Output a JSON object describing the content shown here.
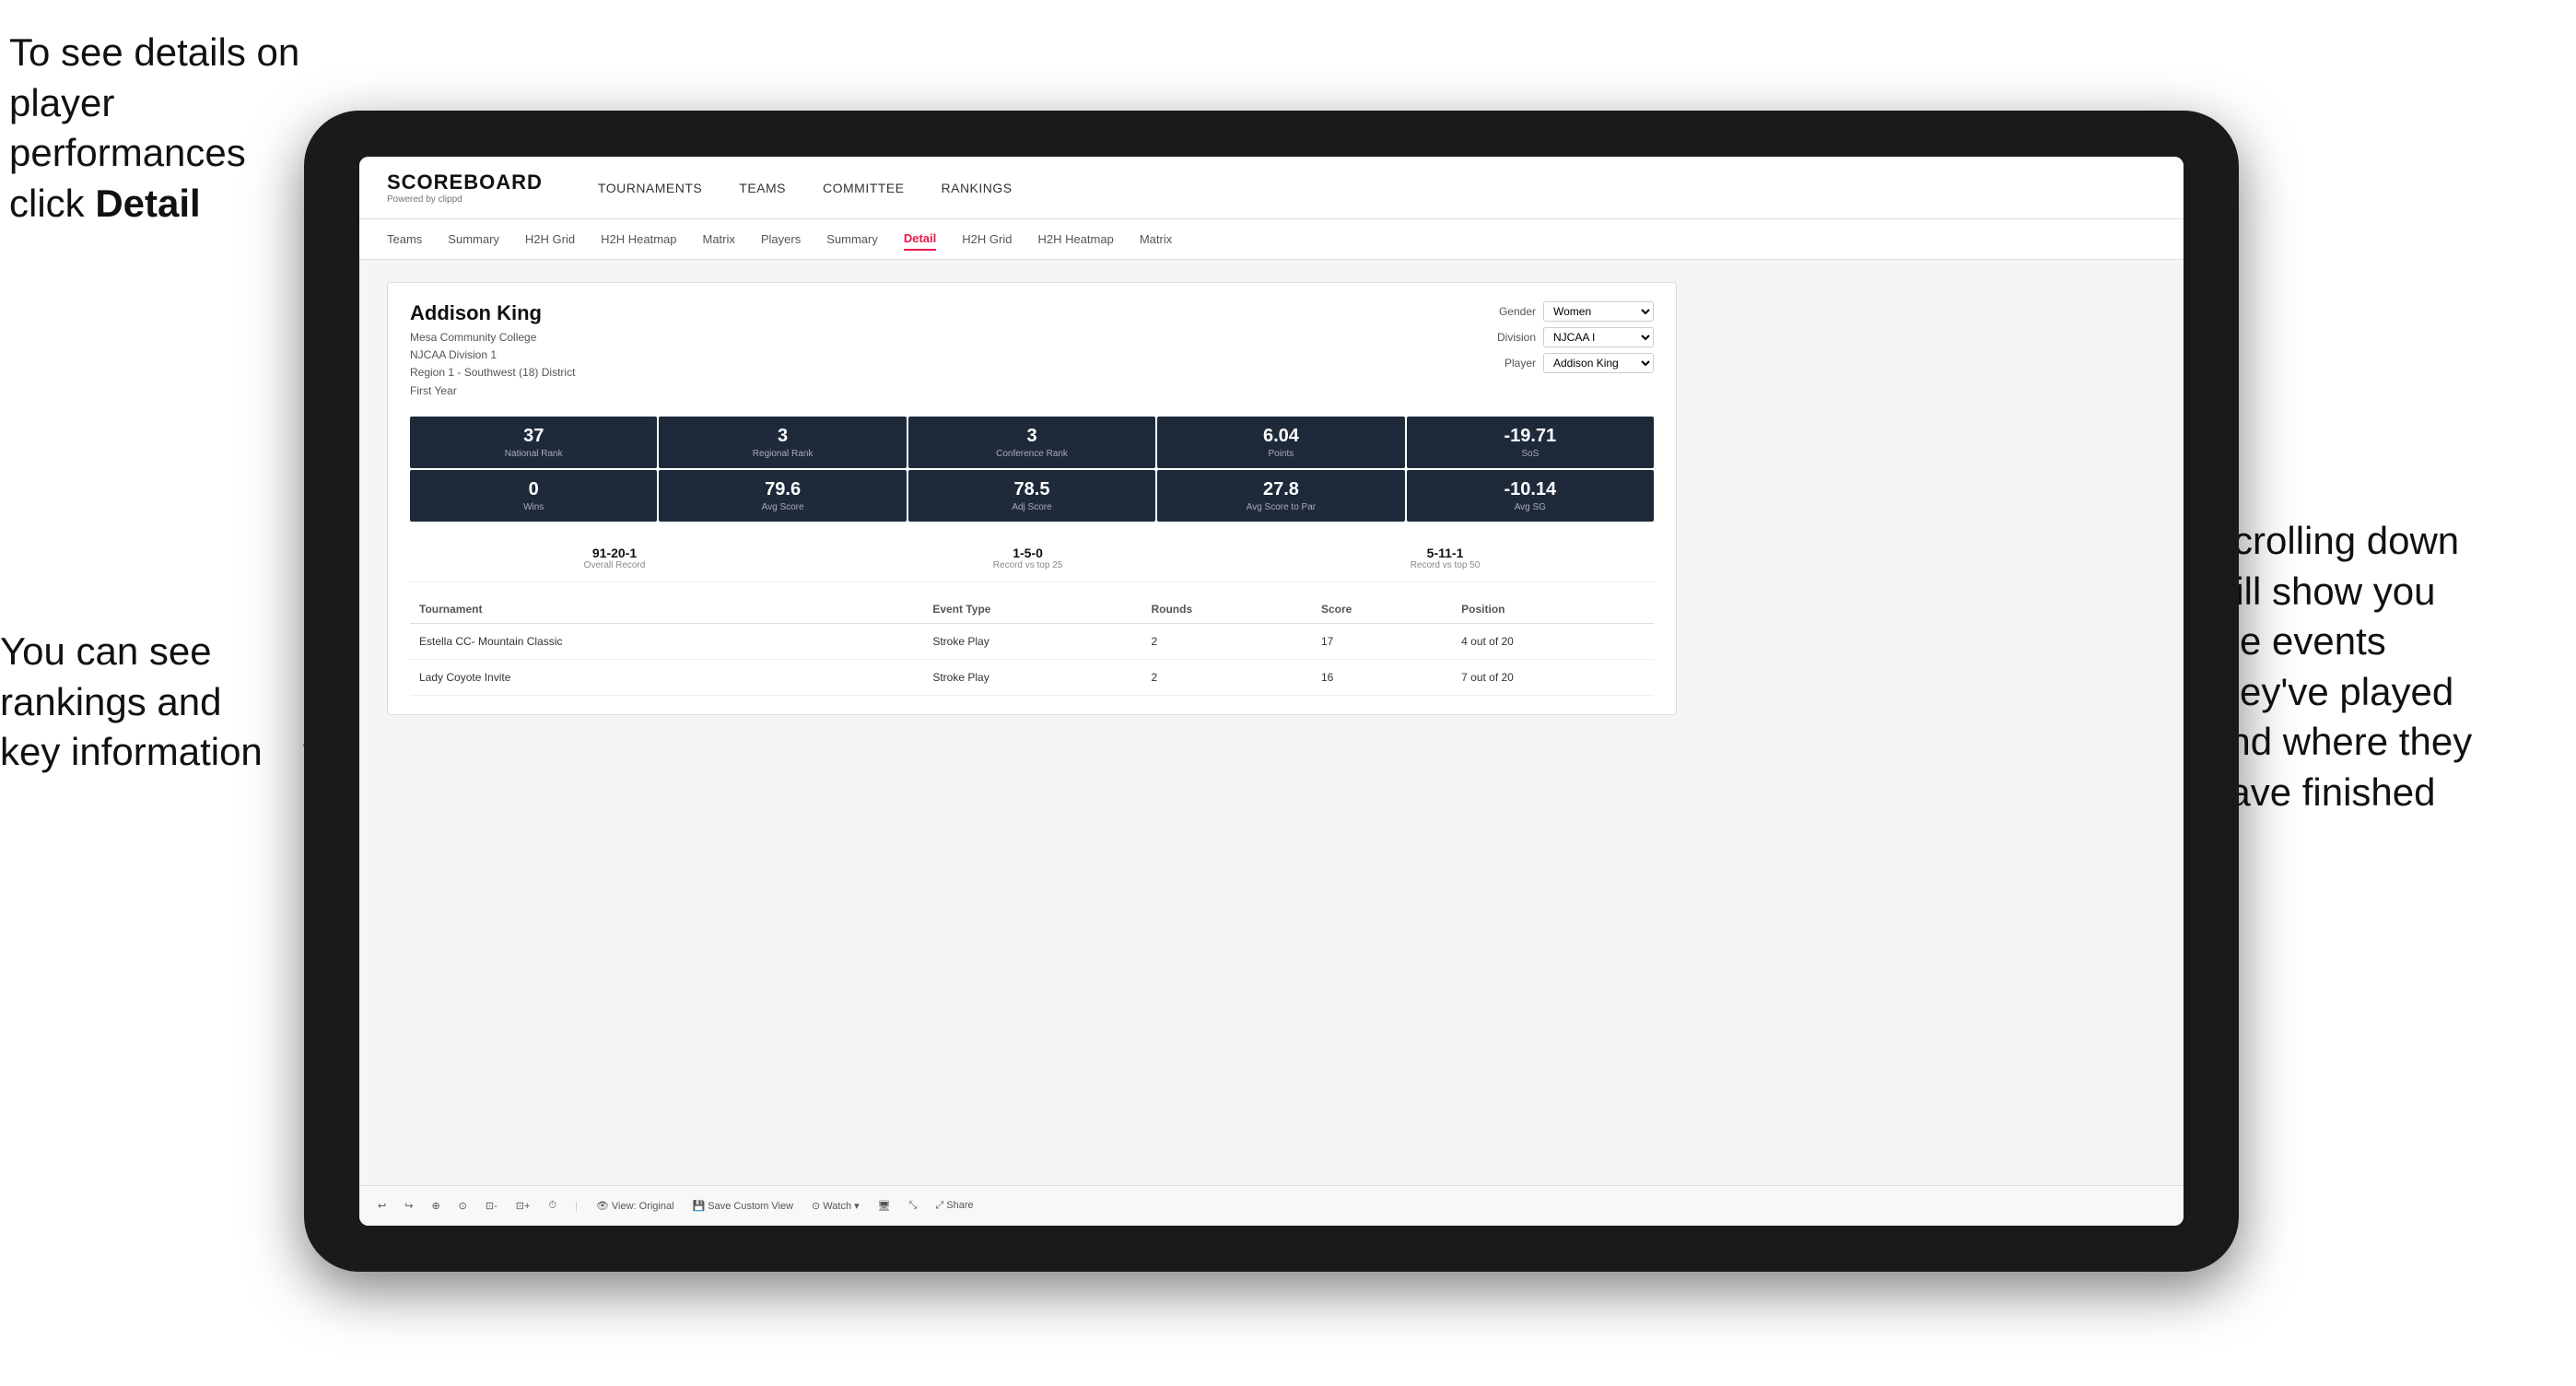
{
  "annotations": {
    "top_left": "To see details on player performances click Detail",
    "top_left_bold": "Detail",
    "bottom_left_line1": "You can see",
    "bottom_left_line2": "rankings and",
    "bottom_left_line3": "key information",
    "right_line1": "Scrolling down",
    "right_line2": "will show you",
    "right_line3": "the events",
    "right_line4": "they've played",
    "right_line5": "and where they",
    "right_line6": "have finished"
  },
  "nav": {
    "logo": "SCOREBOARD",
    "logo_sub": "Powered by clippd",
    "items": [
      {
        "label": "TOURNAMENTS",
        "active": false
      },
      {
        "label": "TEAMS",
        "active": false
      },
      {
        "label": "COMMITTEE",
        "active": false
      },
      {
        "label": "RANKINGS",
        "active": false
      }
    ]
  },
  "sub_nav": {
    "items": [
      {
        "label": "Teams",
        "active": false
      },
      {
        "label": "Summary",
        "active": false
      },
      {
        "label": "H2H Grid",
        "active": false
      },
      {
        "label": "H2H Heatmap",
        "active": false
      },
      {
        "label": "Matrix",
        "active": false
      },
      {
        "label": "Players",
        "active": false
      },
      {
        "label": "Summary",
        "active": false
      },
      {
        "label": "Detail",
        "active": true
      },
      {
        "label": "H2H Grid",
        "active": false
      },
      {
        "label": "H2H Heatmap",
        "active": false
      },
      {
        "label": "Matrix",
        "active": false
      }
    ]
  },
  "player": {
    "name": "Addison King",
    "school": "Mesa Community College",
    "division": "NJCAA Division 1",
    "region": "Region 1 - Southwest (18) District",
    "year": "First Year"
  },
  "filters": {
    "gender_label": "Gender",
    "gender_value": "Women",
    "division_label": "Division",
    "division_value": "NJCAA I",
    "player_label": "Player",
    "player_value": "Addison King"
  },
  "stats_row1": [
    {
      "value": "37",
      "label": "National Rank"
    },
    {
      "value": "3",
      "label": "Regional Rank"
    },
    {
      "value": "3",
      "label": "Conference Rank"
    },
    {
      "value": "6.04",
      "label": "Points"
    },
    {
      "value": "-19.71",
      "label": "SoS"
    }
  ],
  "stats_row2": [
    {
      "value": "0",
      "label": "Wins"
    },
    {
      "value": "79.6",
      "label": "Avg Score"
    },
    {
      "value": "78.5",
      "label": "Adj Score"
    },
    {
      "value": "27.8",
      "label": "Avg Score to Par"
    },
    {
      "value": "-10.14",
      "label": "Avg SG"
    }
  ],
  "records": [
    {
      "value": "91-20-1",
      "label": "Overall Record"
    },
    {
      "value": "1-5-0",
      "label": "Record vs top 25"
    },
    {
      "value": "5-11-1",
      "label": "Record vs top 50"
    }
  ],
  "table": {
    "headers": [
      "Tournament",
      "",
      "Event Type",
      "Rounds",
      "Score",
      "Position"
    ],
    "rows": [
      {
        "tournament": "Estella CC- Mountain Classic",
        "event_type": "Stroke Play",
        "rounds": "2",
        "score": "17",
        "position": "4 out of 20"
      },
      {
        "tournament": "Lady Coyote Invite",
        "event_type": "Stroke Play",
        "rounds": "2",
        "score": "16",
        "position": "7 out of 20"
      }
    ]
  },
  "toolbar": {
    "items": [
      "↩",
      "↪",
      "⊕",
      "⊙",
      "⊡-",
      "⊡+",
      "⏱",
      "|",
      "View: Original",
      "Save Custom View",
      "Watch ▾",
      "🖥",
      "⤡",
      "Share"
    ]
  }
}
